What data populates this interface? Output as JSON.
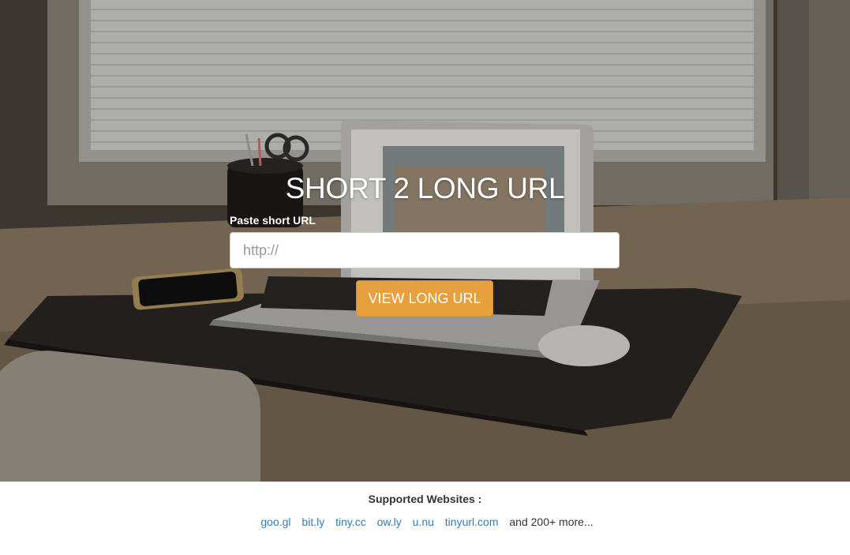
{
  "hero": {
    "title": "SHORT 2 LONG URL",
    "input_label": "Paste short URL",
    "input_placeholder": "http://",
    "input_value": "",
    "submit_label": "VIEW LONG URL"
  },
  "footer": {
    "heading": "Supported Websites :",
    "sites": [
      "goo.gl",
      "bit.ly",
      "tiny.cc",
      "ow.ly",
      "u.nu",
      "tinyurl.com"
    ],
    "more_text": "and 200+ more..."
  },
  "colors": {
    "accent_button": "#e8a03d",
    "link": "#337ab7",
    "text_dark": "#333333"
  }
}
